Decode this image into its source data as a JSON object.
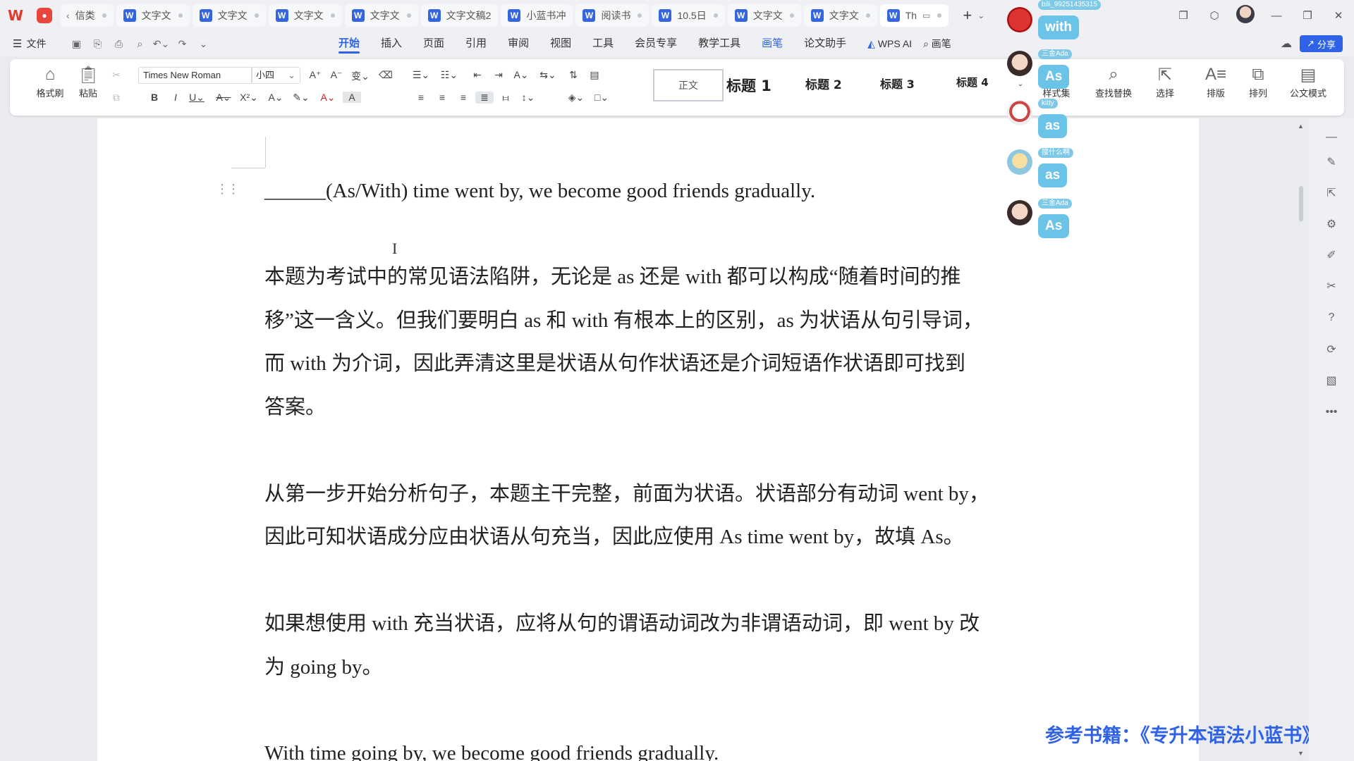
{
  "tabs": {
    "first_label": "信类",
    "items": [
      {
        "label": "文字文"
      },
      {
        "label": "文字文"
      },
      {
        "label": "文字文"
      },
      {
        "label": "文字文"
      },
      {
        "label": "文字文稿2"
      },
      {
        "label": "小蓝书冲"
      },
      {
        "label": "阅读书"
      },
      {
        "label": "10.5日"
      },
      {
        "label": "文字文"
      },
      {
        "label": "文字文"
      },
      {
        "label": "Th"
      }
    ],
    "add": "+"
  },
  "menubar": {
    "file": "文件",
    "items": [
      {
        "label": "开始"
      },
      {
        "label": "插入"
      },
      {
        "label": "页面"
      },
      {
        "label": "引用"
      },
      {
        "label": "审阅"
      },
      {
        "label": "视图"
      },
      {
        "label": "工具"
      },
      {
        "label": "会员专享"
      },
      {
        "label": "教学工具"
      },
      {
        "label": "画笔"
      },
      {
        "label": "论文助手"
      },
      {
        "label": "WPS AI"
      },
      {
        "label": "画笔"
      }
    ],
    "share": "分享"
  },
  "ribbon": {
    "format_painter": "格式刷",
    "paste": "粘贴",
    "font_name": "Times New Roman",
    "font_size": "小四",
    "styles": {
      "normal": "正文",
      "h1": "标题 1",
      "h2": "标题 2",
      "h3": "标题 3",
      "h4": "标题 4"
    },
    "style_set": "样式集",
    "find_replace": "查找替换",
    "select": "选择",
    "layout": "排版",
    "arrange": "排列",
    "official": "公文模式"
  },
  "document": {
    "question": "______(As/With) time went by, we become good friends gradually.",
    "p1": [
      "本题为考试中的常见语法陷阱，无论是 as 还是 with 都可以构成“随着时间的推",
      "移”这一含义。但我们要明白 as 和 with 有根本上的区别，as 为状语从句引导词，",
      "而 with 为介词，因此弄清这里是状语从句作状语还是介词短语作状语即可找到",
      "答案。"
    ],
    "p2": [
      "从第一步开始分析句子，本题主干完整，前面为状语。状语部分有动词 went by，",
      "因此可知状语成分应由状语从句充当，因此应使用 As time went by，故填 As。"
    ],
    "p3": [
      "如果想使用 with 充当状语，应将从句的谓语动词改为非谓语动词，即 went by 改",
      "为 going by。"
    ],
    "p4": "With time going by, we become good friends gradually."
  },
  "footer_note": "参考书籍：《专升本语法小蓝书》",
  "chat": [
    {
      "name": "bili_99251435315",
      "message": "with"
    },
    {
      "name": "三金Ada",
      "message": "As"
    },
    {
      "name": "kitty",
      "message": "as"
    },
    {
      "name": "搜什么啊",
      "message": "as"
    },
    {
      "name": "三金Ada",
      "message": "As"
    }
  ]
}
